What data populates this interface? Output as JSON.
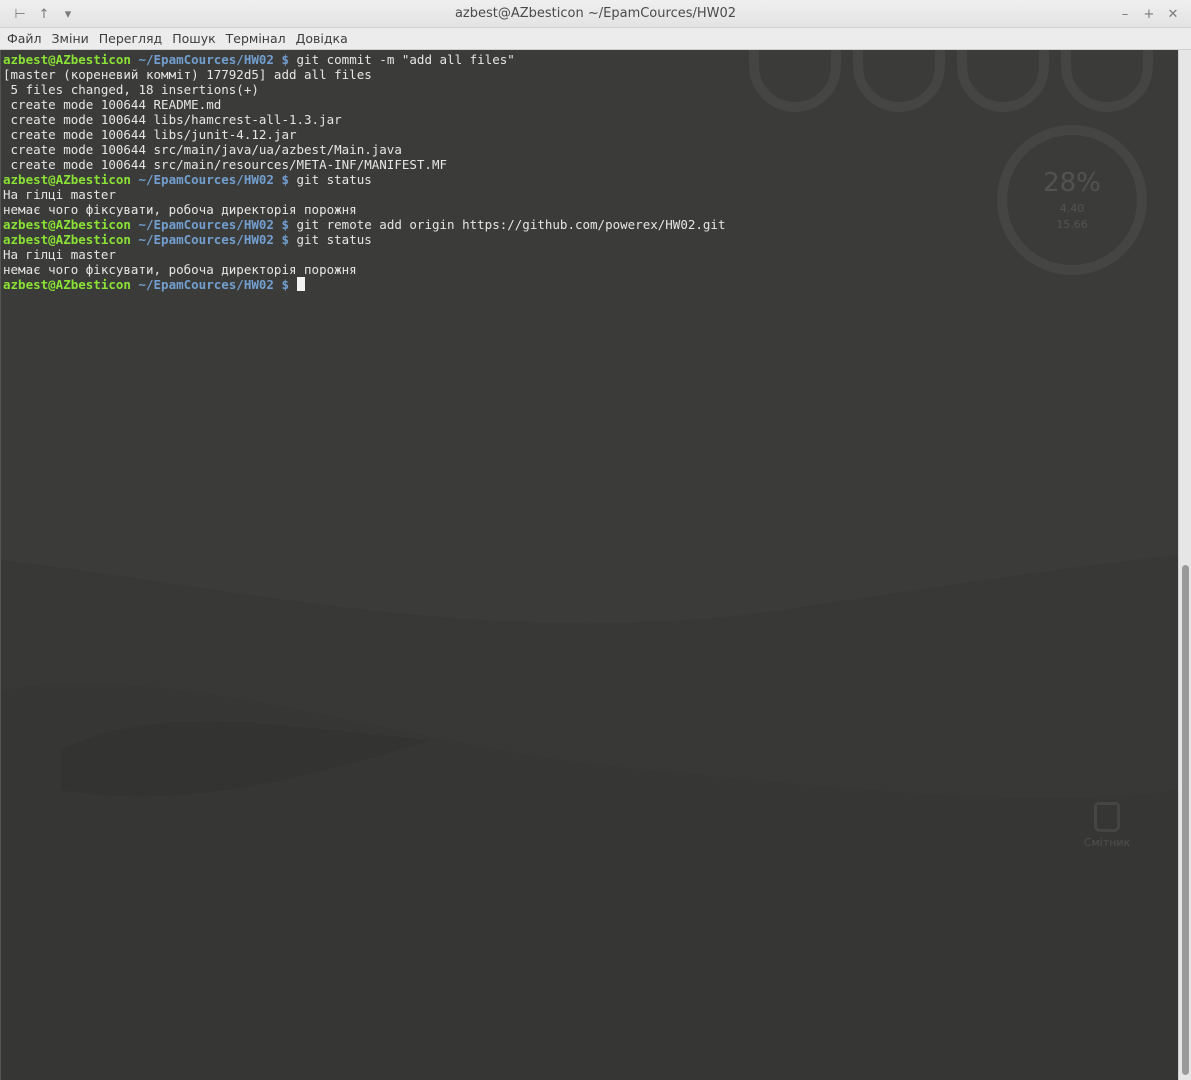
{
  "window": {
    "title": "azbest@AZbesticon ~/EpamCources/HW02",
    "left_buttons": [
      "pin-icon",
      "up-arrow-icon",
      "chevron-down-icon"
    ],
    "right_buttons": [
      "minimize-icon",
      "maximize-icon",
      "close-icon"
    ]
  },
  "menu": {
    "items": [
      "Файл",
      "Зміни",
      "Перегляд",
      "Пошук",
      "Термінал",
      "Довідка"
    ]
  },
  "terminal": {
    "prompt_user": "azbest@AZbesticon",
    "prompt_path": "~/EpamCources/HW02",
    "prompt_symbol": "$",
    "lines": [
      {
        "type": "cmd",
        "text": " git commit -m \"add all files\""
      },
      {
        "type": "out",
        "text": "[master (кореневий комміт) 17792d5] add all files"
      },
      {
        "type": "out",
        "text": " 5 files changed, 18 insertions(+)"
      },
      {
        "type": "out",
        "text": " create mode 100644 README.md"
      },
      {
        "type": "out",
        "text": " create mode 100644 libs/hamcrest-all-1.3.jar"
      },
      {
        "type": "out",
        "text": " create mode 100644 libs/junit-4.12.jar"
      },
      {
        "type": "out",
        "text": " create mode 100644 src/main/java/ua/azbest/Main.java"
      },
      {
        "type": "out",
        "text": " create mode 100644 src/main/resources/META-INF/MANIFEST.MF"
      },
      {
        "type": "cmd",
        "text": " git status"
      },
      {
        "type": "out",
        "text": "На гілці master"
      },
      {
        "type": "out",
        "text": "немає чого фіксувати, робоча директорія порожня"
      },
      {
        "type": "cmd",
        "text": " git remote add origin https://github.com/powerex/HW02.git"
      },
      {
        "type": "cmd",
        "text": " git status"
      },
      {
        "type": "out",
        "text": "На гілці master"
      },
      {
        "type": "out",
        "text": "немає чого фіксувати, робоча директорія порожня"
      },
      {
        "type": "cmd",
        "text": " ",
        "cursor": true
      }
    ]
  },
  "desktop": {
    "cpu_widget": {
      "percent": "28%",
      "val1": "4.40",
      "val2": "15.66"
    },
    "trash_label": "Смітник"
  },
  "colors": {
    "prompt_user": "#8ae234",
    "prompt_path": "#729fcf",
    "terminal_bg": "#3b3b3a",
    "terminal_fg": "#e6e6e6"
  }
}
